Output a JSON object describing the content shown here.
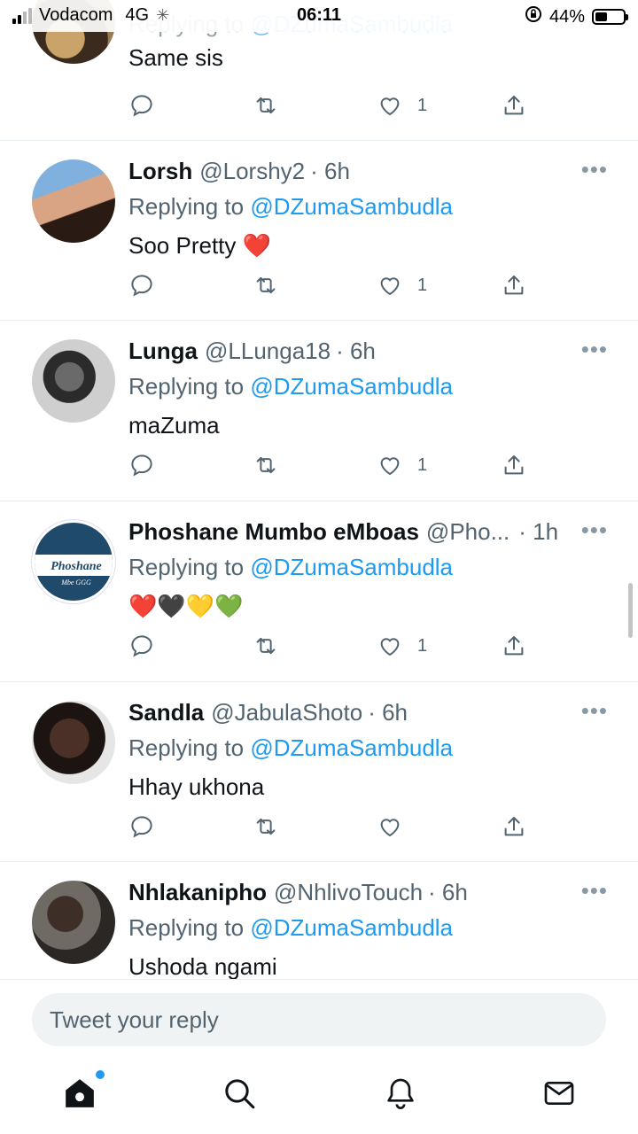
{
  "status_bar": {
    "carrier": "Vodacom",
    "network": "4G",
    "time": "06:11",
    "battery_percent": "44%",
    "battery_level": 0.44
  },
  "feed": {
    "tweets": [
      {
        "display_name": "",
        "handle": "",
        "time": "",
        "reply_prefix": "Replying to",
        "reply_to": "@DZumaSambudla",
        "text": "Same sis",
        "likes": "1"
      },
      {
        "display_name": "Lorsh",
        "handle": "@Lorshy2",
        "time": "· 6h",
        "reply_prefix": "Replying to",
        "reply_to": "@DZumaSambudla",
        "text": "Soo Pretty ❤️",
        "likes": "1"
      },
      {
        "display_name": "Lunga",
        "handle": "@LLunga18",
        "time": "· 6h",
        "reply_prefix": "Replying to",
        "reply_to": "@DZumaSambudla",
        "text": "maZuma",
        "likes": "1"
      },
      {
        "display_name": "Phoshane Mumbo eMboas",
        "handle": "@Pho...",
        "time": "· 1h",
        "reply_prefix": "Replying to",
        "reply_to": "@DZumaSambudla",
        "text": "❤️🖤💛💚",
        "likes": "1",
        "avatar_text": "Phoshane",
        "avatar_subtext": "Mbe GGG"
      },
      {
        "display_name": "Sandla",
        "handle": "@JabulaShoto",
        "time": "· 6h",
        "reply_prefix": "Replying to",
        "reply_to": "@DZumaSambudla",
        "text": "Hhay ukhona",
        "likes": ""
      },
      {
        "display_name": "Nhlakanipho",
        "handle": "@NhlivoTouch",
        "time": "· 6h",
        "reply_prefix": "Replying to",
        "reply_to": "@DZumaSambudla",
        "text": "Ushoda ngami",
        "likes": ""
      }
    ],
    "more_label": "•••"
  },
  "composer": {
    "placeholder": "Tweet your reply"
  },
  "tabbar": {
    "items": [
      "home-icon",
      "search-icon",
      "notifications-icon",
      "messages-icon"
    ]
  },
  "colors": {
    "accent": "#1d9bf0",
    "secondary_text": "#536471",
    "divider": "#e6ecf0"
  }
}
